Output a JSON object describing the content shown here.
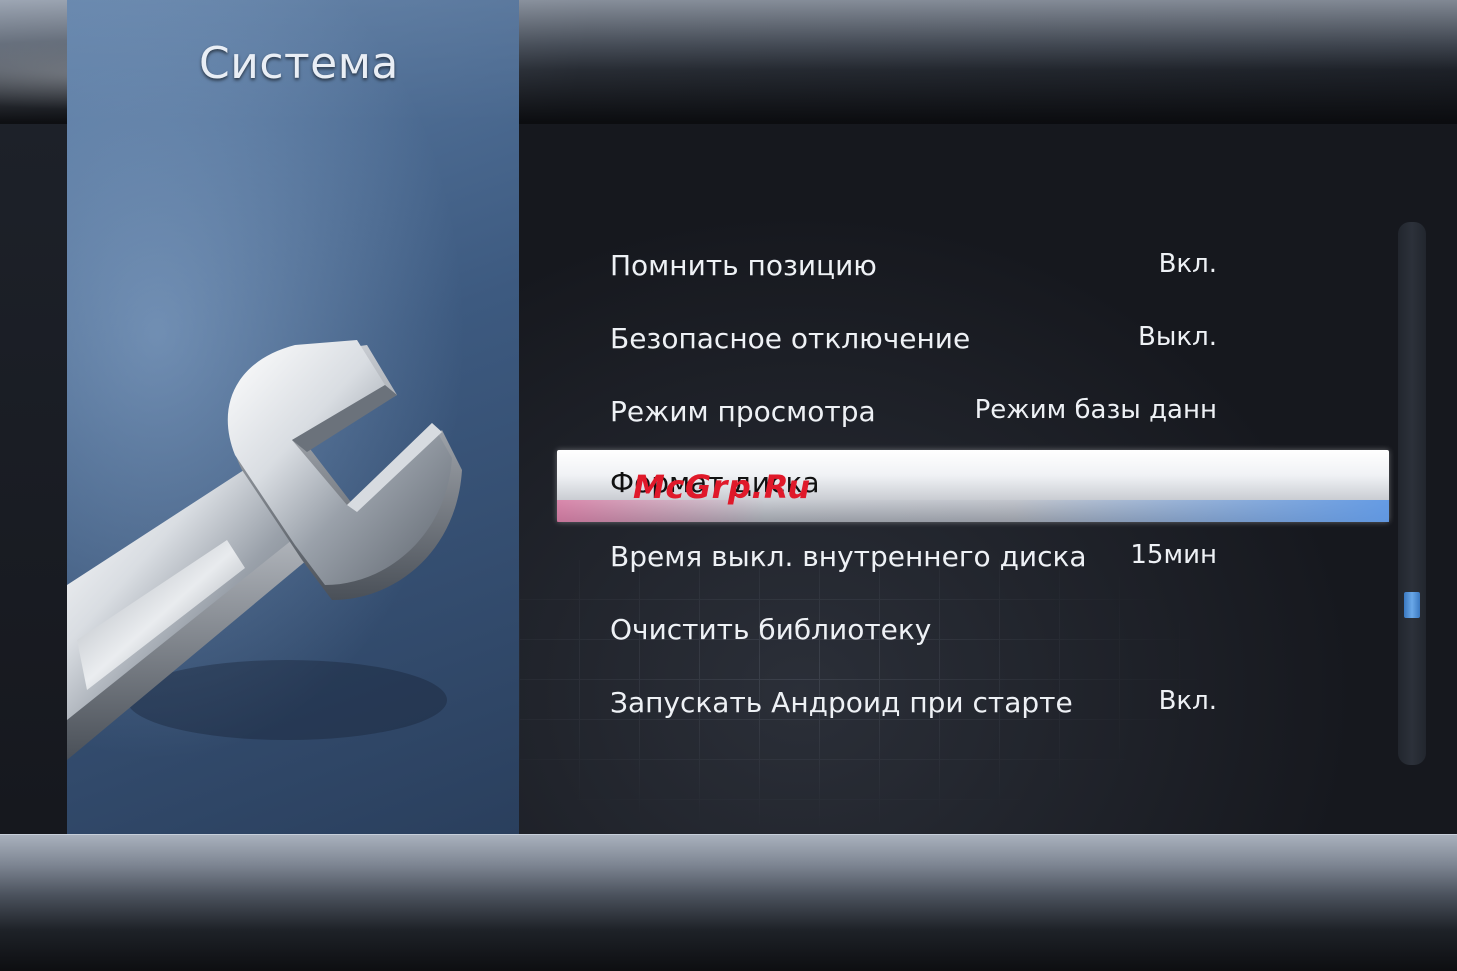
{
  "header": {
    "title": "Система"
  },
  "menu": {
    "items": [
      {
        "label": "Помнить позицию",
        "value": "Вкл.",
        "selected": false
      },
      {
        "label": "Безопасное отключение",
        "value": "Выкл.",
        "selected": false
      },
      {
        "label": "Режим просмотра",
        "value": "Режим базы данн",
        "selected": false
      },
      {
        "label": "Формат диска",
        "value": "",
        "selected": true
      },
      {
        "label": "Время выкл. внутреннего диска",
        "value": "15мин",
        "selected": false
      },
      {
        "label": "Очистить библиотеку",
        "value": "",
        "selected": false
      },
      {
        "label": "Запускать Андроид при старте",
        "value": "Вкл.",
        "selected": false
      }
    ]
  },
  "watermark": {
    "text": "McGrp.Ru"
  },
  "illustration": {
    "icon": "wrench-icon"
  },
  "scrollbar": {
    "position": 0.68
  },
  "colors": {
    "accent": "#4a8fd8",
    "highlight": "#ffffff",
    "watermark": "#e0192a"
  }
}
